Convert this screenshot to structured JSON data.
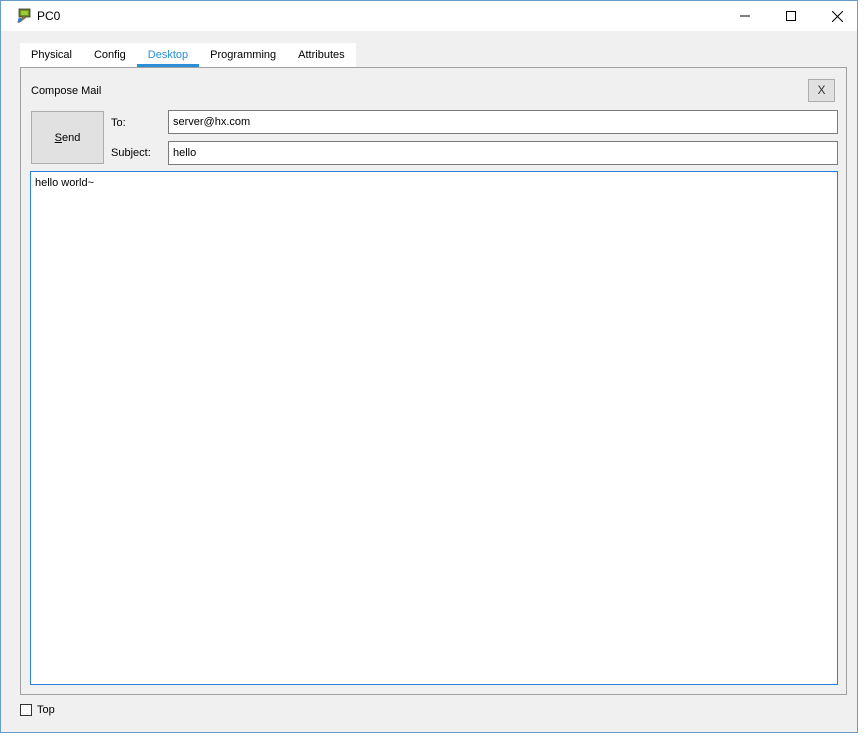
{
  "window": {
    "title": "PC0",
    "controls": {
      "minimize": "minimize-icon",
      "maximize": "maximize-icon",
      "close": "close-icon"
    }
  },
  "tabs": [
    {
      "label": "Physical",
      "active": false
    },
    {
      "label": "Config",
      "active": false
    },
    {
      "label": "Desktop",
      "active": true
    },
    {
      "label": "Programming",
      "active": false
    },
    {
      "label": "Attributes",
      "active": false
    }
  ],
  "compose": {
    "title": "Compose Mail",
    "close_label": "X",
    "send_label_first": "S",
    "send_label_rest": "end",
    "to_label": "To:",
    "to_value": "server@hx.com",
    "subject_label": "Subject:",
    "subject_value": "hello",
    "body": "hello world~"
  },
  "footer": {
    "top_label": "Top",
    "top_checked": false
  },
  "colors": {
    "accent": "#2b8fd6",
    "window_bg": "#f0f0f0"
  }
}
